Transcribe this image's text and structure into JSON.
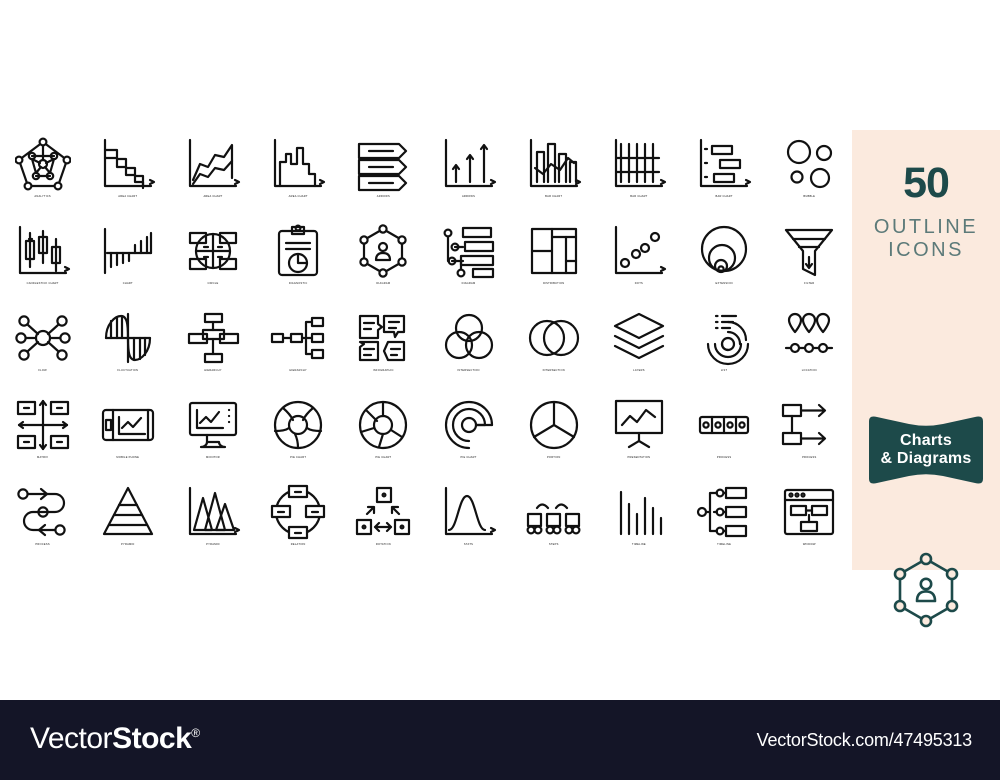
{
  "promo": {
    "count": "50",
    "line1": "OUTLINE",
    "line2": "ICONS",
    "ribbon_line1": "Charts",
    "ribbon_line2": "& Diagrams",
    "panel_bg": "#fbeade",
    "accent": "#1d4a4a",
    "subtitle_color": "#5c7a79",
    "hero_icon": "hexagon-network-person-icon"
  },
  "footer": {
    "brand_light": "Vector",
    "brand_bold": "Stock",
    "brand_mark": "®",
    "url": "VectorStock.com/47495313",
    "bg": "#141527"
  },
  "icons": [
    {
      "label": "ANALYTICS",
      "name": "analytics-icon"
    },
    {
      "label": "AREA CHART",
      "name": "area-chart-descending-icon"
    },
    {
      "label": "AREA CHART",
      "name": "area-chart-ascending-icon"
    },
    {
      "label": "AREA CHART",
      "name": "area-chart-columns-icon"
    },
    {
      "label": "ARROWS",
      "name": "arrows-horizontal-bars-icon"
    },
    {
      "label": "ARROWS",
      "name": "arrows-up-icon"
    },
    {
      "label": "BAR CHART",
      "name": "bar-chart-line-overlay-icon"
    },
    {
      "label": "BAR CHART",
      "name": "bar-chart-vertical-icon"
    },
    {
      "label": "BAR CHART",
      "name": "bar-chart-gantt-icon"
    },
    {
      "label": "BUBBLE",
      "name": "bubble-icon"
    },
    {
      "label": "CANDLESTICK CHART",
      "name": "candlestick-chart-icon"
    },
    {
      "label": "CHART",
      "name": "chart-deviation-icon"
    },
    {
      "label": "CIRCLE",
      "name": "circle-quadrant-icon"
    },
    {
      "label": "DIAGNOSTIC",
      "name": "diagnostic-clipboard-icon"
    },
    {
      "label": "DIAGRAM",
      "name": "diagram-hexagon-person-icon"
    },
    {
      "label": "DIAGRAM",
      "name": "diagram-tree-bars-icon"
    },
    {
      "label": "DISTRIBUTION",
      "name": "distribution-treemap-icon"
    },
    {
      "label": "DOTS",
      "name": "dots-scatter-icon"
    },
    {
      "label": "EXTENSION",
      "name": "extension-circles-icon"
    },
    {
      "label": "FILTER",
      "name": "filter-funnel-icon"
    },
    {
      "label": "FLOW",
      "name": "flow-network-icon"
    },
    {
      "label": "FLUCTUATION",
      "name": "fluctuation-wave-icon"
    },
    {
      "label": "HIERARCHY",
      "name": "hierarchy-org-icon"
    },
    {
      "label": "HIERARCHY",
      "name": "hierarchy-branch-icon"
    },
    {
      "label": "INFOGRAPHIC",
      "name": "infographic-cards-icon"
    },
    {
      "label": "INTERSECTION",
      "name": "intersection-three-circles-icon"
    },
    {
      "label": "INTERSECTION",
      "name": "intersection-two-circles-icon"
    },
    {
      "label": "LAYERS",
      "name": "layers-icon"
    },
    {
      "label": "LIST",
      "name": "list-radar-icon"
    },
    {
      "label": "LOCATION",
      "name": "location-pins-icon"
    },
    {
      "label": "MATRIX",
      "name": "matrix-icon"
    },
    {
      "label": "MOBILE PHONE",
      "name": "mobile-phone-chart-icon"
    },
    {
      "label": "MONITOR",
      "name": "monitor-chart-icon"
    },
    {
      "label": "PIE CHART",
      "name": "pie-chart-donut-segments-icon"
    },
    {
      "label": "PIE CHART",
      "name": "pie-chart-donut-icon"
    },
    {
      "label": "PIE CHART",
      "name": "pie-chart-spiral-icon"
    },
    {
      "label": "PORTION",
      "name": "portion-pie-thirds-icon"
    },
    {
      "label": "PRESENTATION",
      "name": "presentation-board-icon"
    },
    {
      "label": "PROCESS",
      "name": "process-progress-bar-icon"
    },
    {
      "label": "PROCESS",
      "name": "process-arrows-icon"
    },
    {
      "label": "PROCESS",
      "name": "process-snake-flow-icon"
    },
    {
      "label": "PYRAMID",
      "name": "pyramid-layers-icon"
    },
    {
      "label": "PYRAMID",
      "name": "pyramid-peaks-chart-icon"
    },
    {
      "label": "RELATION",
      "name": "relation-circle-nodes-icon"
    },
    {
      "label": "ROTATION",
      "name": "rotation-arrows-icon"
    },
    {
      "label": "STATS",
      "name": "stats-bell-curve-icon"
    },
    {
      "label": "STEPS",
      "name": "steps-icon"
    },
    {
      "label": "TIMELINE",
      "name": "timeline-bars-icon"
    },
    {
      "label": "TIMELINE",
      "name": "timeline-branch-icon"
    },
    {
      "label": "WINDOW",
      "name": "window-flowchart-icon"
    }
  ]
}
